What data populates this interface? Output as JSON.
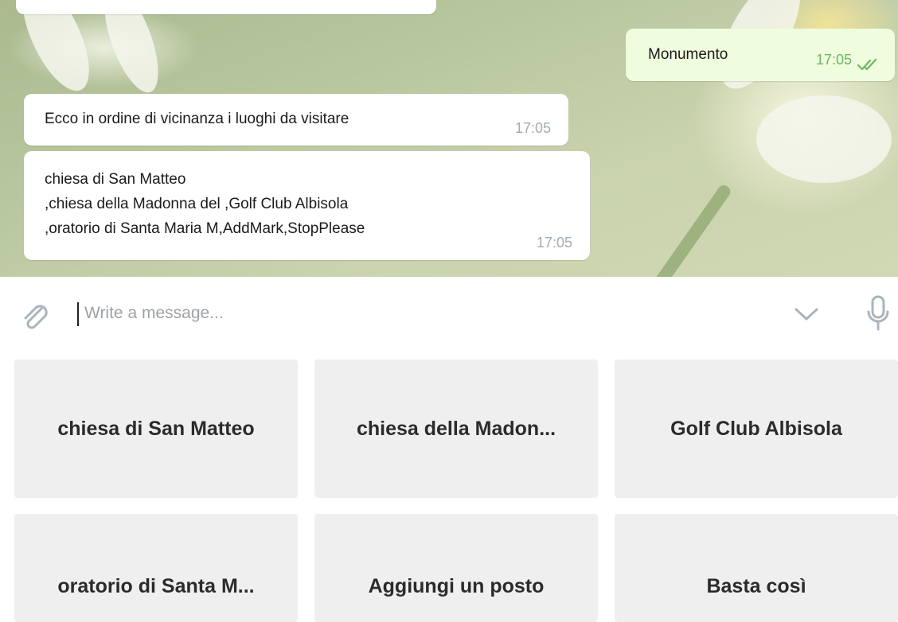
{
  "messages": [
    {
      "id": "out",
      "text": "Monumento",
      "time": "17:05",
      "status": "read"
    },
    {
      "id": "in1",
      "text": "Ecco in ordine di vicinanza i luoghi da visitare",
      "time": "17:05"
    },
    {
      "id": "in2",
      "lines": [
        "chiesa di San Matteo",
        ",chiesa della Madonna del ,Golf Club Albisola",
        ",oratorio di Santa Maria M,AddMark,StopPlease"
      ],
      "time": "17:05"
    }
  ],
  "composer": {
    "placeholder": "Write a message..."
  },
  "keyboard": {
    "rows": [
      [
        "chiesa di San Matteo",
        "chiesa della Madon...",
        "Golf Club Albisola"
      ],
      [
        "oratorio di Santa M...",
        "Aggiungi un posto",
        "Basta così"
      ]
    ]
  },
  "colors": {
    "outgoing_bubble": "#effdde",
    "incoming_bubble": "#ffffff",
    "check_green": "#6cb863",
    "keyboard_button": "#efefef"
  },
  "icons": [
    "paperclip-icon",
    "chevron-down-icon",
    "microphone-icon",
    "double-check-icon"
  ]
}
